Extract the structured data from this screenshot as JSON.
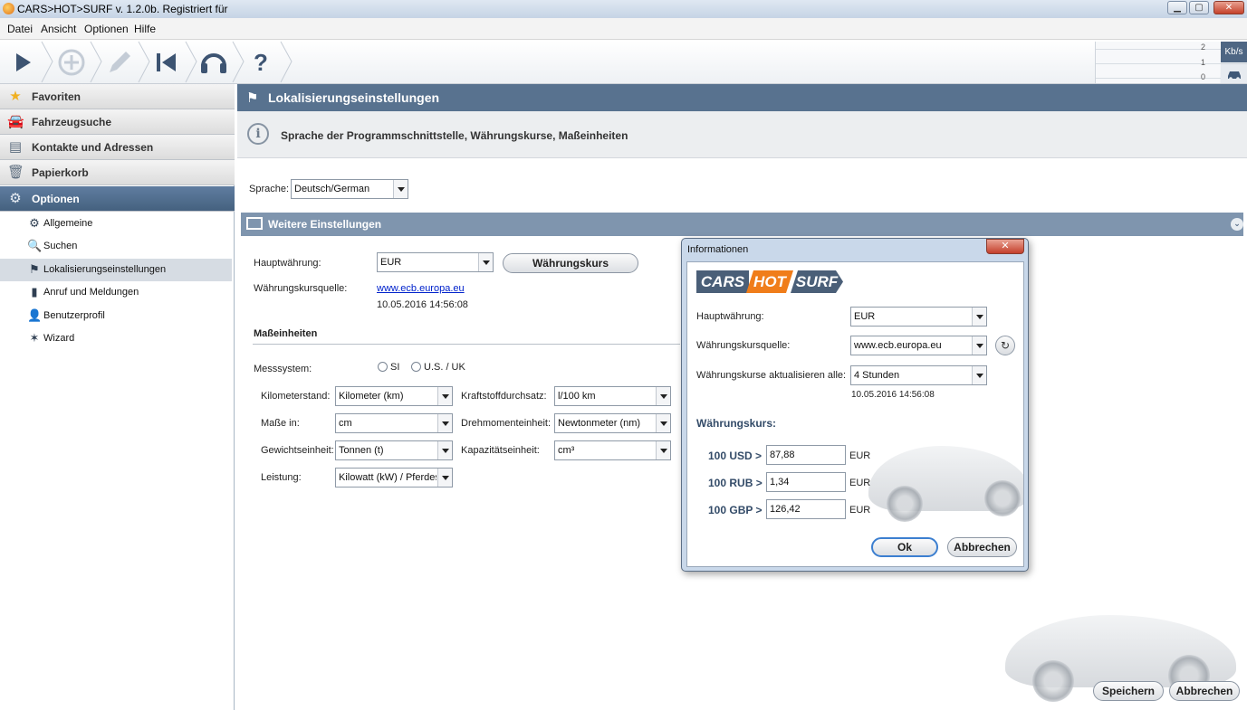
{
  "window": {
    "title": "CARS>HOT>SURF v. 1.2.0b. Registriert für",
    "minimize": "▁",
    "maximize": "▢",
    "close": "✕"
  },
  "menu": [
    "Datei",
    "Ansicht",
    "Optionen",
    "Hilfe"
  ],
  "toolbar": {
    "icons": [
      "play-icon",
      "add-icon",
      "edit-icon",
      "back-to-start-icon",
      "headset-icon",
      "help-icon"
    ],
    "help_glyph": "?"
  },
  "network": {
    "ticks": [
      "2",
      "1",
      "0"
    ],
    "unit": "Kb/s"
  },
  "sidebar": {
    "categories": [
      {
        "label": "Favoriten",
        "icon": "star-icon"
      },
      {
        "label": "Fahrzeugsuche",
        "icon": "car-search-icon"
      },
      {
        "label": "Kontakte und Adressen",
        "icon": "contacts-icon"
      },
      {
        "label": "Papierkorb",
        "icon": "trash-icon"
      },
      {
        "label": "Optionen",
        "icon": "gear-icon"
      }
    ],
    "items": [
      {
        "label": "Allgemeine",
        "icon": "gears-icon"
      },
      {
        "label": "Suchen",
        "icon": "search-icon"
      },
      {
        "label": "Lokalisierungseinstellungen",
        "icon": "flag-icon"
      },
      {
        "label": "Anruf und Meldungen",
        "icon": "phone-icon"
      },
      {
        "label": "Benutzerprofil",
        "icon": "user-profile-icon"
      },
      {
        "label": "Wizard",
        "icon": "wand-icon"
      }
    ]
  },
  "main": {
    "header": "Lokalisierungseinstellungen",
    "info": "Sprache der Programmschnittstelle, Währungskurse, Maßeinheiten",
    "language_label": "Sprache:",
    "language_value": "Deutsch/German",
    "weitere": "Weitere Einstellungen",
    "hauptwaehrung_label": "Hauptwährung:",
    "hauptwaehrung_value": "EUR",
    "waehrungskurs_button": "Währungskurs",
    "quelle_label": "Währungskursquelle:",
    "quelle_link": "www.ecb.europa.eu",
    "quelle_date": "10.05.2016 14:56:08",
    "masseinheiten": "Maßeinheiten",
    "messsystem_label": "Messsystem:",
    "radio_si": "SI",
    "radio_us": "U.S. / UK",
    "fields": {
      "kilometerstand_label": "Kilometerstand:",
      "kilometerstand_value": "Kilometer (km)",
      "masse_label": "Maße in:",
      "masse_value": "cm",
      "gewicht_label": "Gewichtseinheit:",
      "gewicht_value": "Tonnen (t)",
      "leistung_label": "Leistung:",
      "leistung_value": "Kilowatt (kW) / Pferdest",
      "kraftstoff_label": "Kraftstoffdurchsatz:",
      "kraftstoff_value": "l/100 km",
      "drehmoment_label": "Drehmomenteinheit:",
      "drehmoment_value": "Newtonmeter (nm)",
      "kapazitaet_label": "Kapazitätseinheit:",
      "kapazitaet_value": "cm³"
    },
    "save_button": "Speichern",
    "cancel_button": "Abbrechen"
  },
  "dialog": {
    "title": "Informationen",
    "close": "✕",
    "logo": [
      "CARS",
      "HOT",
      "SURF"
    ],
    "hauptwaehrung_label": "Hauptwährung:",
    "hauptwaehrung_value": "EUR",
    "quelle_label": "Währungskursquelle:",
    "quelle_value": "www.ecb.europa.eu",
    "refresh_glyph": "↻",
    "update_label": "Währungskurse aktualisieren alle:",
    "update_value": "4 Stunden",
    "update_date": "10.05.2016 14:56:08",
    "rates_title": "Währungskurs:",
    "rates": [
      {
        "label": "100 USD >",
        "value": "87,88",
        "unit": "EUR"
      },
      {
        "label": "100 RUB >",
        "value": "1,34",
        "unit": "EUR"
      },
      {
        "label": "100 GBP >",
        "value": "126,42",
        "unit": "EUR"
      }
    ],
    "ok_button": "Ok",
    "cancel_button": "Abbrechen"
  },
  "colors": {
    "accent": "#58728f",
    "logo_dark": "#4a5f78",
    "logo_orange": "#f07d1a"
  }
}
